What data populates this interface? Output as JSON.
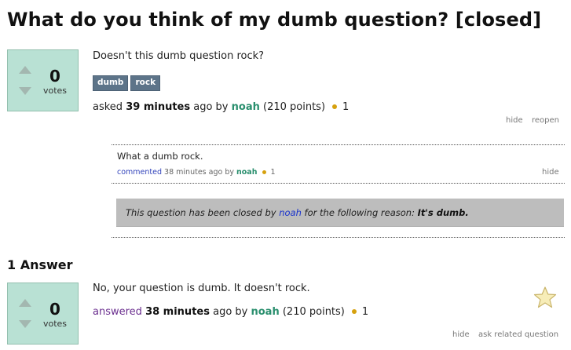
{
  "question": {
    "title": "What do you think of my dumb question? [closed]",
    "votes": "0",
    "votes_label": "votes",
    "body": "Doesn't this dumb question rock?",
    "tags": [
      "dumb",
      "rock"
    ],
    "asked_verb": "asked",
    "asked_time": "39 minutes",
    "asked_ago": "ago by",
    "author": "noah",
    "author_points": "(210 points)",
    "badge_count": "1",
    "links": {
      "hide": "hide",
      "reopen": "reopen"
    }
  },
  "comment": {
    "text": "What a dumb rock.",
    "verb": "commented",
    "time": "38 minutes ago by",
    "author": "noah",
    "badge_count": "1",
    "hide": "hide"
  },
  "closed_notice": {
    "prefix": "This question has been closed by",
    "user": "noah",
    "middle": "for the following reason:",
    "reason": "It's dumb."
  },
  "answers": {
    "heading": "1 Answer",
    "items": [
      {
        "votes": "0",
        "votes_label": "votes",
        "body": "No, your question is dumb. It doesn't rock.",
        "verb": "answered",
        "time": "38 minutes",
        "ago": "ago by",
        "author": "noah",
        "author_points": "(210 points)",
        "badge_count": "1",
        "links": {
          "hide": "hide",
          "ask_related": "ask related question"
        }
      }
    ]
  },
  "colors": {
    "vote_box": "#b9e1d4",
    "tag_bg": "#5d7489",
    "user_link": "#2a8f6e",
    "badge_dot": "#d6a10e",
    "closed_bg": "#bdbdbd"
  },
  "icons": [
    "vote-up-arrow-icon",
    "vote-down-arrow-icon",
    "badge-dot-icon",
    "favorite-star-icon"
  ]
}
